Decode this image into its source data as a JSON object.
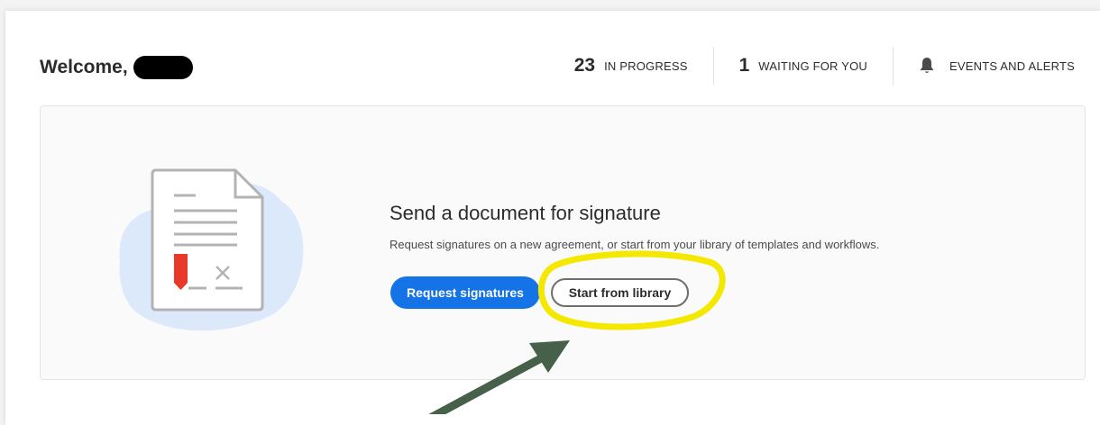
{
  "header": {
    "welcome": "Welcome,",
    "stats": [
      {
        "count": "23",
        "label": "IN PROGRESS"
      },
      {
        "count": "1",
        "label": "WAITING FOR YOU"
      }
    ],
    "alerts_label": "EVENTS AND ALERTS"
  },
  "send": {
    "title": "Send a document for signature",
    "description": "Request signatures on a new agreement, or start from your library of templates and workflows.",
    "request_button": "Request signatures",
    "library_button": "Start from library"
  },
  "icons": {
    "bell": "bell-icon",
    "illustration": "document-signature-illustration"
  },
  "colors": {
    "primary": "#1473e6",
    "highlight": "#f5e800",
    "arrow": "#46604a",
    "illustration_blob": "#dbe9fb",
    "signature_tab": "#e8392b"
  }
}
